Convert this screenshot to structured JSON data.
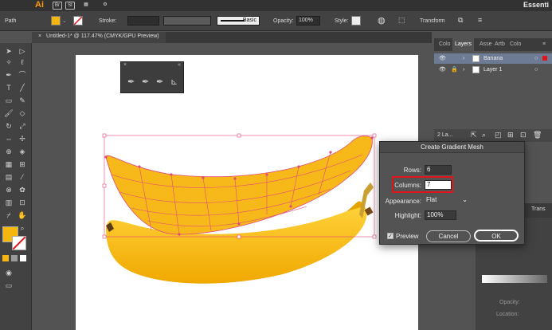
{
  "app": {
    "logo": "Ai",
    "bridge": "Br",
    "stock": "St",
    "workspace": "Essenti"
  },
  "control_bar": {
    "selection": "Path",
    "stroke_label": "Stroke:",
    "brush_label": "Basic",
    "opacity_label": "Opacity:",
    "opacity_value": "100%",
    "style_label": "Style:",
    "transform_label": "Transform",
    "colors": {
      "fill": "#f5b70d"
    }
  },
  "document": {
    "tab_title": "Untitled-1* @ 117.47% (CMYK/GPU Preview)",
    "close_symbol": "×"
  },
  "dialog": {
    "title": "Create Gradient Mesh",
    "rows_label": "Rows:",
    "rows_value": "6",
    "columns_label": "Columns:",
    "columns_value": "7",
    "appearance_label": "Appearance:",
    "appearance_value": "Flat",
    "highlight_label": "Highlight:",
    "highlight_value": "100%",
    "preview_label": "Preview",
    "preview_checked": true,
    "cancel_label": "Cancel",
    "ok_label": "OK",
    "highlight_color": "#e0141b"
  },
  "layers_panel": {
    "tabs": [
      "Colo",
      "Layers",
      "Asse",
      "Artb",
      "Colo"
    ],
    "active_tab": "Layers",
    "layers": [
      {
        "name": "Banana"
      },
      {
        "name": "Layer 1"
      }
    ],
    "count_label": "2 La..."
  },
  "lower_panels": {
    "tab_label": "Trans",
    "opacity_label": "Opacity:",
    "location_label": "Location:"
  }
}
